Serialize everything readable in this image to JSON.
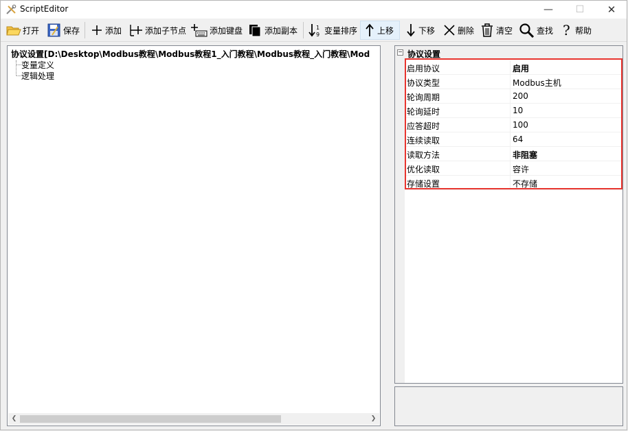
{
  "window": {
    "title": "ScriptEditor"
  },
  "toolbar": {
    "open": "打开",
    "save": "保存",
    "add": "添加",
    "add_child": "添加子节点",
    "add_keyboard": "添加键盘",
    "add_copy": "添加副本",
    "sort_vars": "变量排序",
    "move_up": "上移",
    "move_down": "下移",
    "delete": "删除",
    "clear": "清空",
    "find": "查找",
    "help": "帮助"
  },
  "tree": {
    "root": "协议设置[D:\\Desktop\\Modbus教程\\Modbus教程1_入门教程\\Modbus教程_入门教程\\Mod",
    "children": [
      "变量定义",
      "逻辑处理"
    ]
  },
  "properties": {
    "category": "协议设置",
    "rows": [
      {
        "name": "启用协议",
        "value": "启用",
        "bold": true
      },
      {
        "name": "协议类型",
        "value": "Modbus主机",
        "bold": false
      },
      {
        "name": "轮询周期",
        "value": "200",
        "bold": false
      },
      {
        "name": "轮询延时",
        "value": "10",
        "bold": false
      },
      {
        "name": "应答超时",
        "value": "100",
        "bold": false
      },
      {
        "name": "连续读取",
        "value": "64",
        "bold": false
      },
      {
        "name": "读取方法",
        "value": "非阻塞",
        "bold": true
      },
      {
        "name": "优化读取",
        "value": "容许",
        "bold": false
      },
      {
        "name": "存储设置",
        "value": "不存储",
        "bold": false
      }
    ]
  },
  "colors": {
    "highlight": "#e8342e",
    "accent": "#e5f1fb"
  }
}
